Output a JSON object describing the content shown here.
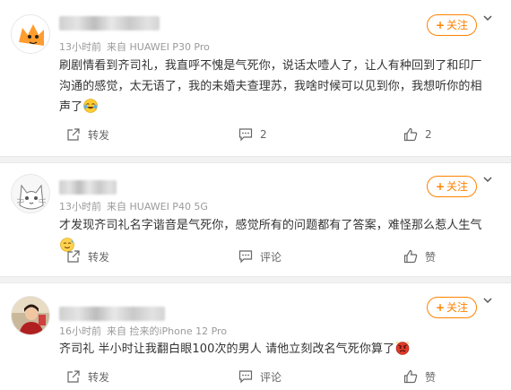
{
  "posts": [
    {
      "avatar_icon": "cartoon-orange-cat-avatar",
      "meta": {
        "time": "13小时前",
        "source": "来自 HUAWEI P30 Pro"
      },
      "text": "刷剧情看到齐司礼，我直呼不愧是气死你，说话太噎人了，让人有种回到了和印厂沟通的感觉，太无语了，我的未婚夫查理苏，我啥时候可以见到你，我想听你的相声了",
      "trailing_emoji": "crying-laughing-emoji",
      "follow_label": "关注",
      "actions": {
        "repost": "转发",
        "comment": "2",
        "like": "2"
      }
    },
    {
      "avatar_icon": "sketched-cat-avatar",
      "meta": {
        "time": "13小时前",
        "source": "来自 HUAWEI P40 5G"
      },
      "text": "才发现齐司礼名字谐音是气死你，感觉所有的问题都有了答案，难怪那么惹人生气",
      "trailing_emoji": "sweating-smile-emoji",
      "follow_label": "关注",
      "actions": {
        "repost": "转发",
        "comment": "评论",
        "like": "赞"
      }
    },
    {
      "avatar_icon": "photo-person-avatar",
      "meta": {
        "time": "16小时前",
        "source": "来自 捡来的iPhone 12 Pro"
      },
      "text": "齐司礼 半小时让我翻白眼100次的男人 请他立刻改名气死你算了",
      "trailing_emoji": "angry-face-emoji",
      "follow_label": "关注",
      "actions": {
        "repost": "转发",
        "comment": "评论",
        "like": "赞"
      }
    }
  ],
  "colors": {
    "accent": "#ff8200",
    "meta": "#9a9a9a",
    "text": "#333333"
  }
}
